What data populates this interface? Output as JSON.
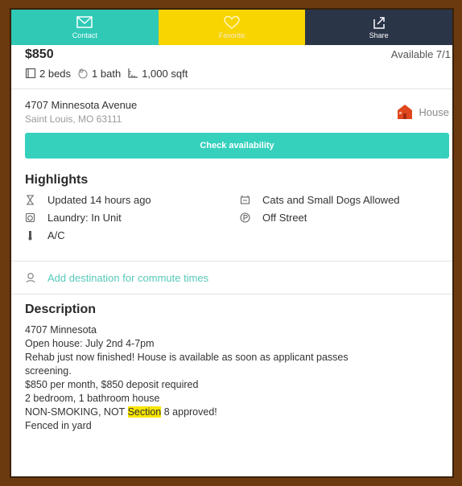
{
  "actions": [
    {
      "label": "Contact",
      "icon": "mail-icon"
    },
    {
      "label": "Favorite",
      "icon": "heart-icon"
    },
    {
      "label": "Share",
      "icon": "share-icon"
    }
  ],
  "listing": {
    "price": "$850",
    "available": "Available 7/1",
    "beds": "2 beds",
    "baths": "1 bath",
    "sqft": "1,000 sqft",
    "address_line1": "4707 Minnesota Avenue",
    "address_line2": "Saint Louis, MO 63111",
    "property_type": "House"
  },
  "check_button": "Check availability",
  "highlights": {
    "title": "Highlights",
    "items": [
      {
        "text": "Updated 14 hours ago",
        "icon": "hourglass-icon"
      },
      {
        "text": "Cats and Small Dogs Allowed",
        "icon": "pet-icon"
      },
      {
        "text": "Laundry: In Unit",
        "icon": "laundry-icon"
      },
      {
        "text": "Off Street",
        "icon": "parking-icon"
      },
      {
        "text": "A/C",
        "icon": "thermometer-icon"
      }
    ]
  },
  "commute": {
    "text": "Add destination for commute times",
    "icon": "location-pin-icon"
  },
  "description": {
    "title": "Description",
    "lines": [
      "4707 Minnesota",
      "Open house: July 2nd 4-7pm",
      " Rehab just now finished! House is available as soon as applicant passes",
      "screening.",
      " $850 per month, $850 deposit required",
      "2 bedroom, 1 bathroom house"
    ],
    "line7_before": " NON-SMOKING, NOT ",
    "line7_highlight": "Section",
    "line7_after": " 8 approved!",
    "line8": " Fenced in yard"
  },
  "colors": {
    "contact": "#2fc9b6",
    "favorite": "#f8d500",
    "share": "#2b3548",
    "accent": "#36d1bd",
    "frame": "#6b3a0f"
  }
}
